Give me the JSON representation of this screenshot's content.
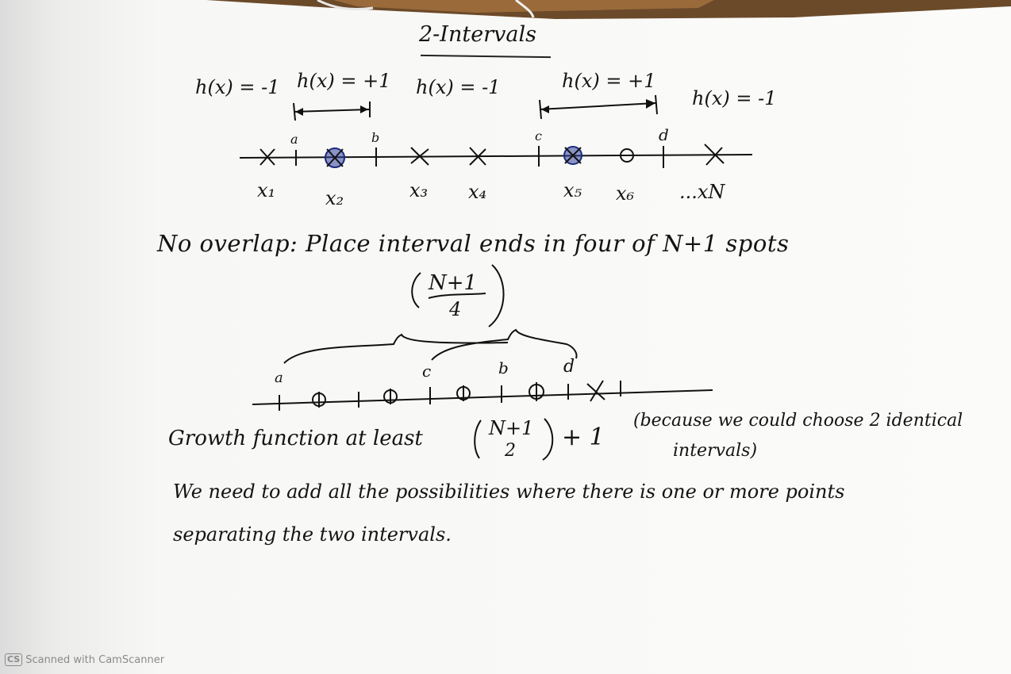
{
  "title": "2-Intervals",
  "top_hypotheses": [
    "h(x) = -1",
    "h(x) = +1",
    "h(x) = -1",
    "h(x) = +1",
    "h(x) = -1"
  ],
  "top_endpoint_labels": [
    "a",
    "b",
    "c",
    "d"
  ],
  "point_labels": [
    "x₁",
    "x₂",
    "x₃",
    "x₄",
    "x₅",
    "x₆",
    "...xN"
  ],
  "no_overlap_text": "No overlap: Place interval ends in four of N+1 spots",
  "binom_top": "N+1",
  "binom_bottom": "4",
  "bottom_endpoint_labels": [
    "a",
    "c",
    "b",
    "d"
  ],
  "growth_text": "Growth function at least",
  "growth_binom_top": "N+1",
  "growth_binom_bottom": "2",
  "growth_plus": "+ 1",
  "growth_note_line1": "(because we could choose 2 identical",
  "growth_note_line2": "intervals)",
  "need_line1": "We need to add all the possibilities where there is one or more points",
  "need_line2": "separating the two intervals.",
  "watermark": "Scanned with CamScanner",
  "watermark_icon": "CS",
  "colors": {
    "ink": "#141414",
    "circle_fill": "#2f3f9e"
  }
}
